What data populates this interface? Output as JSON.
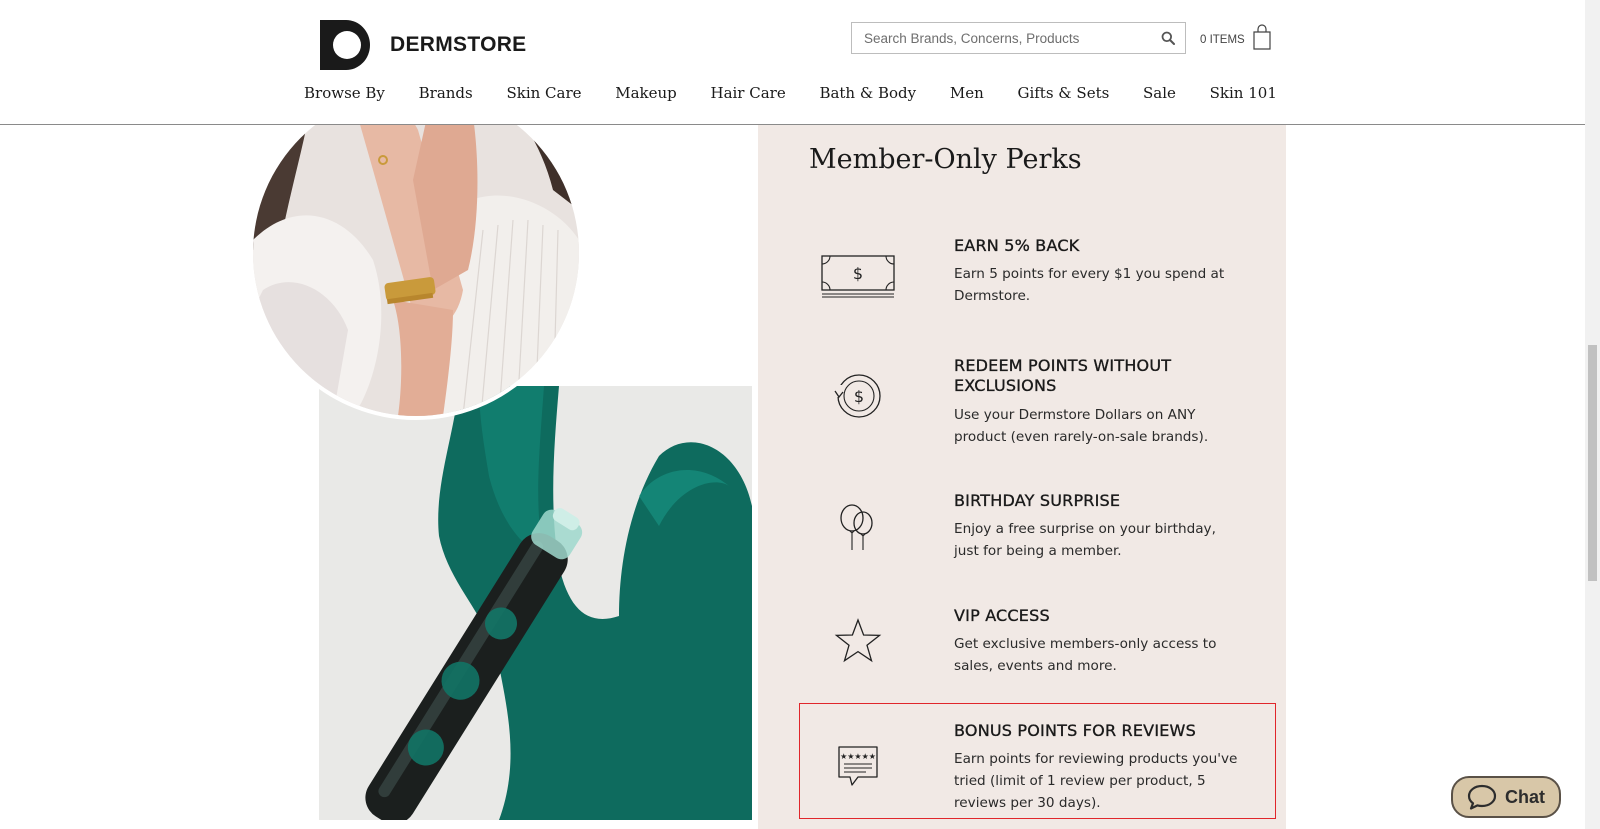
{
  "header": {
    "logo_text": "DERMSTORE",
    "search": {
      "placeholder": "Search Brands, Concerns, Products",
      "value": ""
    },
    "cart_label": "0 ITEMS",
    "nav": [
      "Browse By",
      "Brands",
      "Skin Care",
      "Makeup",
      "Hair Care",
      "Bath & Body",
      "Men",
      "Gifts & Sets",
      "Sale",
      "Skin 101"
    ]
  },
  "perks": {
    "title": "Member-Only Perks",
    "background": "#f1e9e5",
    "items": [
      {
        "icon": "dollar-bill-icon",
        "heading": "EARN 5% BACK",
        "desc": "Earn 5 points for every $1 you spend at Dermstore."
      },
      {
        "icon": "redeem-coin-icon",
        "heading": "REDEEM POINTS WITHOUT EXCLUSIONS",
        "desc": "Use your Dermstore Dollars on ANY product (even rarely-on-sale brands)."
      },
      {
        "icon": "balloons-icon",
        "heading": "BIRTHDAY SURPRISE",
        "desc": "Enjoy a free surprise on your birthday, just for being a member."
      },
      {
        "icon": "star-icon",
        "heading": "VIP ACCESS",
        "desc": "Get exclusive members-only access to sales, events and more."
      },
      {
        "icon": "review-bubble-icon",
        "heading": "BONUS POINTS FOR REVIEWS",
        "desc": "Earn points for reviewing products you've tried (limit of 1 review per product, 5 reviews per 30 days)."
      }
    ]
  },
  "chat": {
    "label": "Chat"
  },
  "colors": {
    "highlight": "#e0262b",
    "chat_bg": "#d8c7a8",
    "serum": "#0e6b5e"
  }
}
